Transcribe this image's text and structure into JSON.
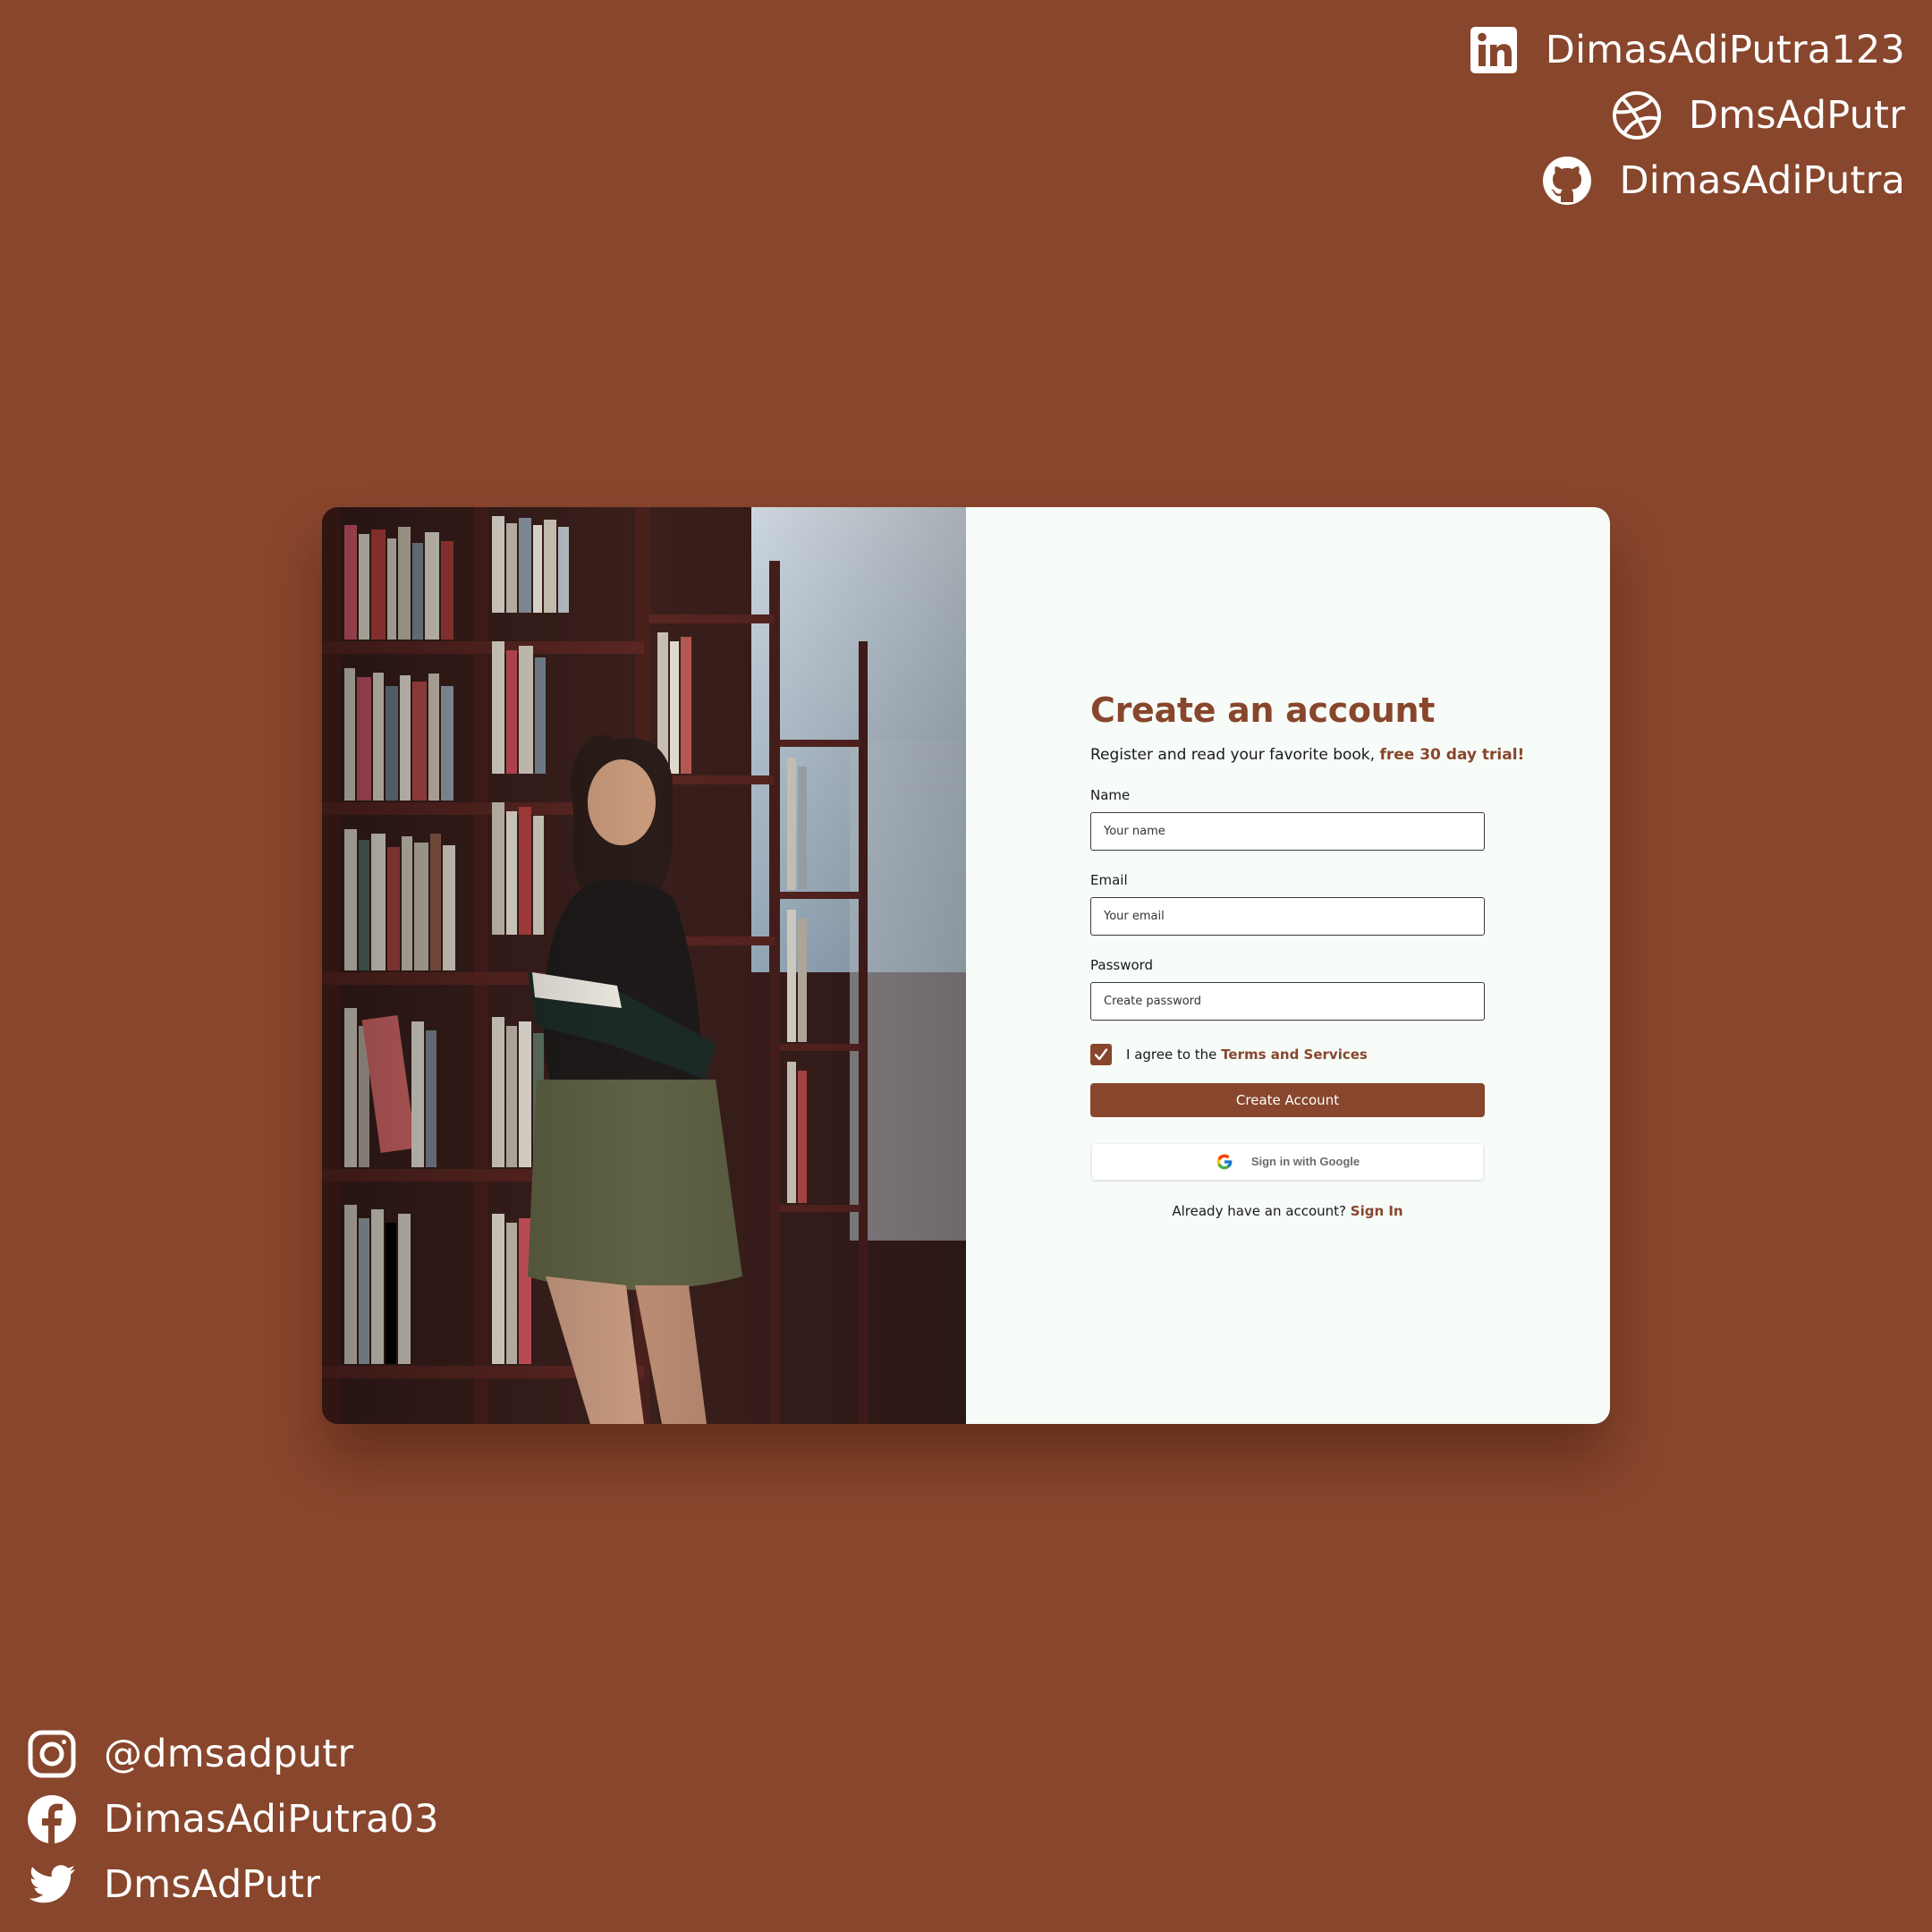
{
  "colors": {
    "background": "#88462c",
    "accent": "#88462c",
    "panel": "#f7fcf8",
    "text": "#ffffff"
  },
  "social_top": [
    {
      "icon": "linkedin-icon",
      "handle": "DimasAdiPutra123"
    },
    {
      "icon": "dribbble-icon",
      "handle": "DmsAdPutr"
    },
    {
      "icon": "github-icon",
      "handle": "DimasAdiPutra"
    }
  ],
  "social_bottom": [
    {
      "icon": "instagram-icon",
      "handle": "@dmsadputr"
    },
    {
      "icon": "facebook-icon",
      "handle": "DimasAdiPutra03"
    },
    {
      "icon": "twitter-icon",
      "handle": "DmsAdPutr"
    }
  ],
  "form": {
    "title": "Create an account",
    "subtitle_text": "Register and read your favorite book, ",
    "subtitle_accent": "free 30 day trial!",
    "name": {
      "label": "Name",
      "placeholder": "Your name"
    },
    "email": {
      "label": "Email",
      "placeholder": "Your email"
    },
    "password": {
      "label": "Password",
      "placeholder": "Create password"
    },
    "agree_text": "I agree to the ",
    "agree_link": "Terms and Services",
    "agree_checked": true,
    "submit_label": "Create Account",
    "google_label": "Sign in with Google",
    "signin_text": "Already have an account? ",
    "signin_link": "Sign In"
  }
}
